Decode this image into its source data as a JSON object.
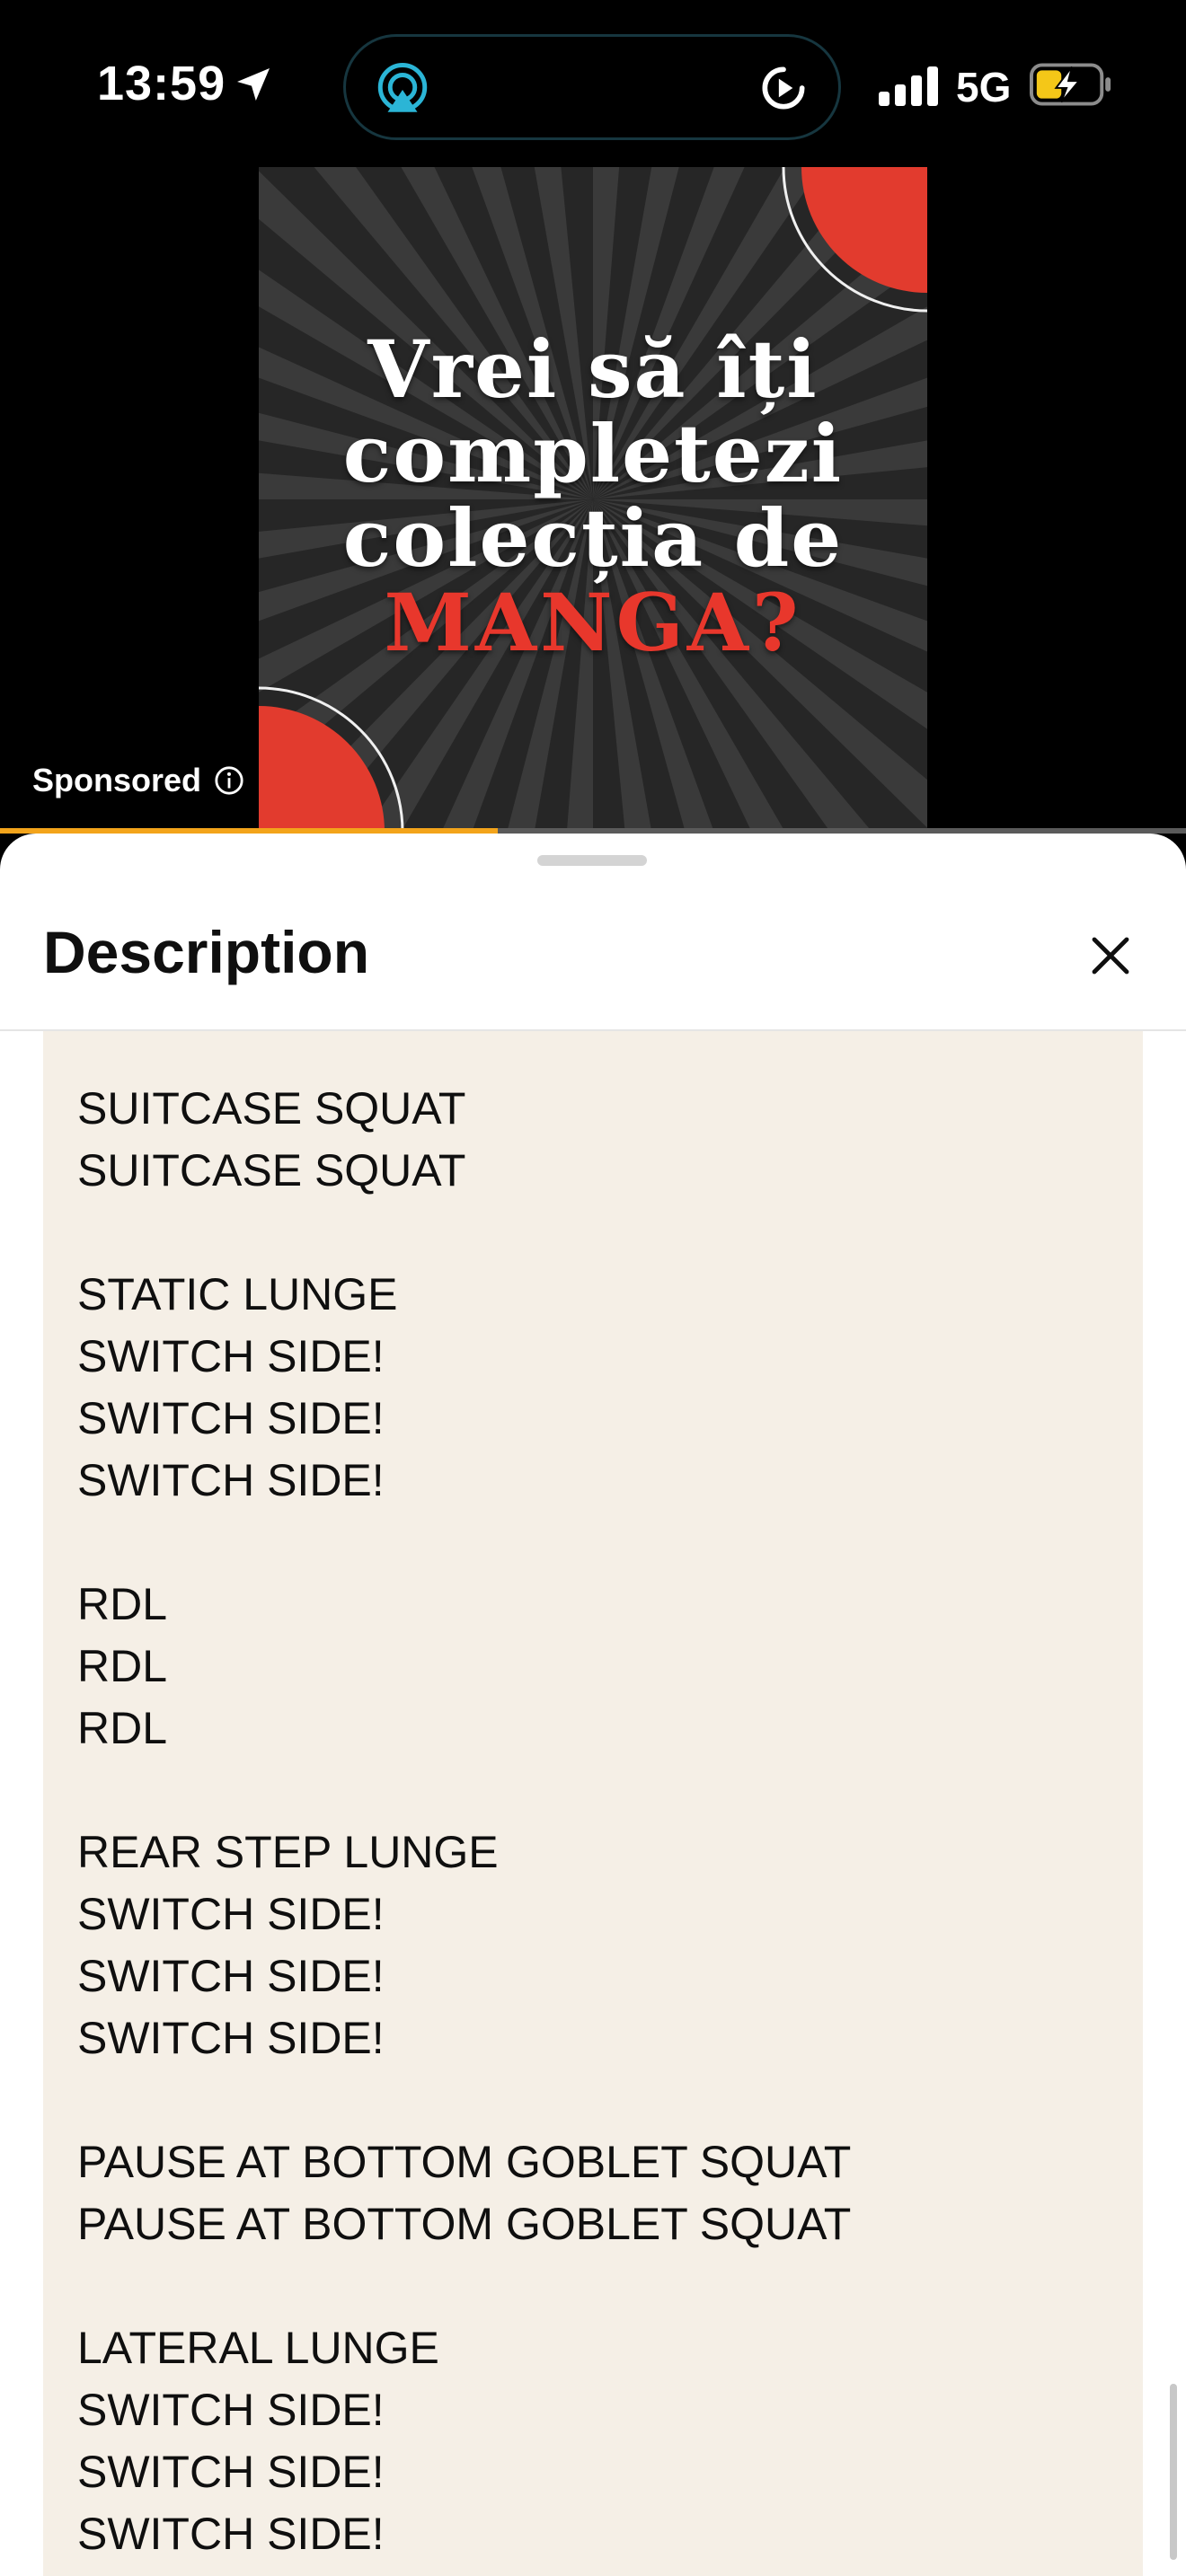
{
  "status_bar": {
    "time": "13:59",
    "network": "5G",
    "icons": [
      "location-arrow-icon",
      "airplay-icon",
      "replay-icon",
      "signal-icon",
      "battery-charging-icon"
    ]
  },
  "ad": {
    "headline_line1": "Vrei să îți",
    "headline_line2": "completezi",
    "headline_line3": "colecția de",
    "headline_accent": "MANGA?",
    "sponsored_label": "Sponsored",
    "progress": 0.42,
    "colors": {
      "accent": "#e8372c",
      "progress": "#f3a41b"
    }
  },
  "sheet": {
    "title": "Description",
    "body": "SUITCASE SQUAT\nSUITCASE SQUAT\n\nSTATIC LUNGE\nSWITCH SIDE!\nSWITCH SIDE!\nSWITCH SIDE!\n\nRDL\nRDL\nRDL\n\nREAR STEP LUNGE\nSWITCH SIDE!\nSWITCH SIDE!\nSWITCH SIDE!\n\nPAUSE AT BOTTOM GOBLET SQUAT\nPAUSE AT BOTTOM GOBLET SQUAT\n\nLATERAL LUNGE\nSWITCH SIDE!\nSWITCH SIDE!\nSWITCH SIDE!"
  }
}
